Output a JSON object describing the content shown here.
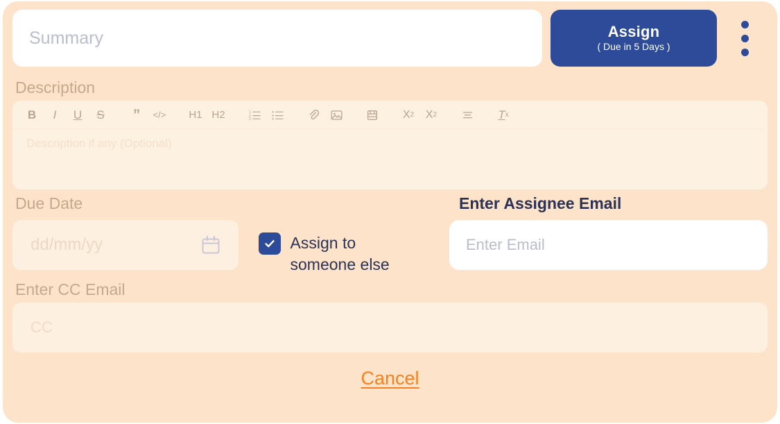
{
  "summary": {
    "placeholder": "Summary",
    "value": ""
  },
  "assign_button": {
    "label": "Assign",
    "sub_label": "( Due in 5 Days )"
  },
  "kebab": {
    "name": "more-options"
  },
  "description": {
    "label": "Description",
    "placeholder": "Description if any (Optional)",
    "value": "",
    "toolbar": [
      {
        "name": "bold-icon",
        "glyph": "B"
      },
      {
        "name": "italic-icon",
        "glyph": "I"
      },
      {
        "name": "underline-icon",
        "glyph": "U"
      },
      {
        "name": "strikethrough-icon",
        "glyph": "S"
      },
      {
        "name": "blockquote-icon",
        "glyph": "”"
      },
      {
        "name": "code-block-icon",
        "glyph": "</>"
      },
      {
        "name": "heading-1-icon",
        "glyph": "H1"
      },
      {
        "name": "heading-2-icon",
        "glyph": "H2"
      },
      {
        "name": "ordered-list-icon",
        "glyph": ""
      },
      {
        "name": "bullet-list-icon",
        "glyph": ""
      },
      {
        "name": "attachment-icon",
        "glyph": ""
      },
      {
        "name": "image-icon",
        "glyph": ""
      },
      {
        "name": "video-icon",
        "glyph": ""
      },
      {
        "name": "subscript-icon",
        "glyph": "X2"
      },
      {
        "name": "superscript-icon",
        "glyph": "X2"
      },
      {
        "name": "align-icon",
        "glyph": ""
      },
      {
        "name": "clear-format-icon",
        "glyph": "Tx"
      }
    ]
  },
  "due_date": {
    "label": "Due Date",
    "placeholder": "dd/mm/yy",
    "value": ""
  },
  "assign_someone": {
    "label_line1": "Assign to",
    "label_line2": "someone else",
    "checked": true
  },
  "assignee_email": {
    "label": "Enter Assignee Email",
    "placeholder": "Enter Email",
    "value": ""
  },
  "cc_email": {
    "label": "Enter CC Email",
    "placeholder": "CC",
    "value": ""
  },
  "cancel": {
    "label": "Cancel"
  },
  "colors": {
    "card_background": "#fce3c9",
    "panel_background": "#fdf0e0",
    "accent_blue": "#2d4b98",
    "cancel_orange": "#f58220",
    "muted_label": "#c6a98d",
    "active_label": "#2c3255"
  }
}
